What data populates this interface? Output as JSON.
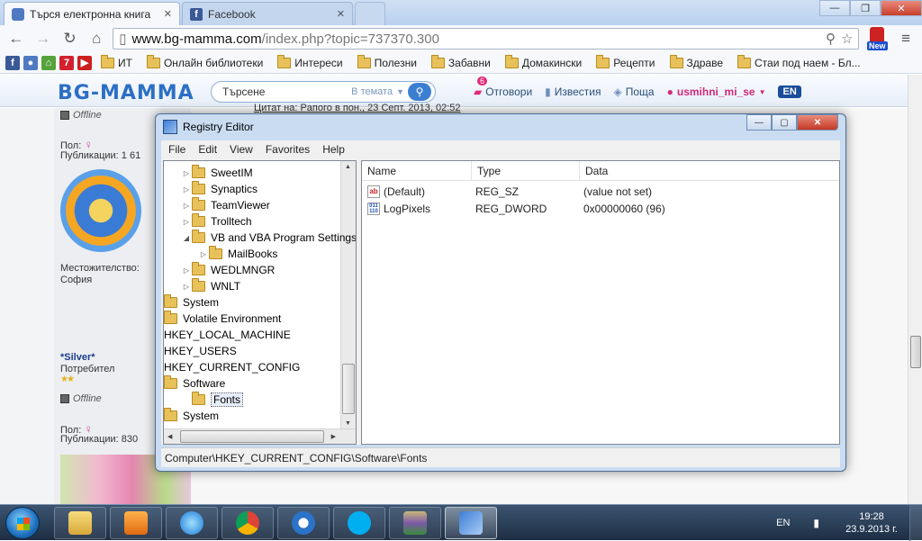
{
  "browser": {
    "tabs": [
      {
        "title": "Търся електронна книга",
        "active": true,
        "icon": "bg-mamma-favicon"
      },
      {
        "title": "Facebook",
        "active": false,
        "icon": "facebook-favicon"
      }
    ],
    "url_domain": "www.bg-mamma.com",
    "url_path": "/index.php?topic=737370.300",
    "extension_badge": "New"
  },
  "bookmarks": [
    {
      "label": "ИТ"
    },
    {
      "label": "Онлайн библиотеки"
    },
    {
      "label": "Интереси"
    },
    {
      "label": "Полезни"
    },
    {
      "label": "Забавни"
    },
    {
      "label": "Домакински"
    },
    {
      "label": "Рецепти"
    },
    {
      "label": "Здраве"
    },
    {
      "label": "Стаи под наем - Бл..."
    }
  ],
  "site": {
    "logo": "BG-MAMMA",
    "search_placeholder": "Търсене",
    "search_scope": "В темата",
    "nav": {
      "replies_label": "Отговори",
      "replies_count": "6",
      "news_label": "Известия",
      "mail_label": "Поща",
      "username": "usmihni_mi_se",
      "lang": "EN"
    },
    "quote_line": "Цитат на: Paпого в пон., 23 Септ. 2013, 02:52",
    "post1": {
      "status": "Offline",
      "gender_label": "Пол:",
      "posts_label": "Публикации: 1 61",
      "location_label": "Местожителство:",
      "location": "София"
    },
    "post2": {
      "name": "*Silver*",
      "role": "Потребител",
      "status": "Offline",
      "gender_label": "Пол:",
      "posts_label": "Публикации: 830"
    }
  },
  "regedit": {
    "title": "Registry Editor",
    "menu": [
      "File",
      "Edit",
      "View",
      "Favorites",
      "Help"
    ],
    "tree": [
      {
        "label": "SweetIM",
        "indent": 1,
        "expander": "▷",
        "folder": true
      },
      {
        "label": "Synaptics",
        "indent": 1,
        "expander": "▷",
        "folder": true
      },
      {
        "label": "TeamViewer",
        "indent": 1,
        "expander": "▷",
        "folder": true
      },
      {
        "label": "Trolltech",
        "indent": 1,
        "expander": "▷",
        "folder": true
      },
      {
        "label": "VB and VBA Program Settings",
        "indent": 1,
        "expander": "◢",
        "folder": true
      },
      {
        "label": "MailBooks",
        "indent": 2,
        "expander": "▷",
        "folder": true
      },
      {
        "label": "WEDLMNGR",
        "indent": 1,
        "expander": "▷",
        "folder": true
      },
      {
        "label": "WNLT",
        "indent": 1,
        "expander": "▷",
        "folder": true
      },
      {
        "label": "System",
        "indent": 0,
        "expander": "",
        "folder": true
      },
      {
        "label": "Volatile Environment",
        "indent": 0,
        "expander": "",
        "folder": true
      },
      {
        "label": "HKEY_LOCAL_MACHINE",
        "indent": 0,
        "expander": "",
        "folder": false
      },
      {
        "label": "HKEY_USERS",
        "indent": 0,
        "expander": "",
        "folder": false
      },
      {
        "label": "HKEY_CURRENT_CONFIG",
        "indent": 0,
        "expander": "",
        "folder": false
      },
      {
        "label": "Software",
        "indent": 0,
        "expander": "",
        "folder": true
      },
      {
        "label": "Fonts",
        "indent": 1,
        "expander": "",
        "folder": true,
        "selected": true
      },
      {
        "label": "System",
        "indent": 0,
        "expander": "",
        "folder": true
      }
    ],
    "columns": [
      "Name",
      "Type",
      "Data"
    ],
    "values": [
      {
        "name": "(Default)",
        "type": "REG_SZ",
        "data": "(value not set)",
        "icon": "string-value-icon"
      },
      {
        "name": "LogPixels",
        "type": "REG_DWORD",
        "data": "0x00000060 (96)",
        "icon": "binary-value-icon"
      }
    ],
    "status_path": "Computer\\HKEY_CURRENT_CONFIG\\Software\\Fonts"
  },
  "taskbar": {
    "apps": [
      "file-explorer",
      "media-player",
      "internet-explorer",
      "chrome",
      "maxthon",
      "skype",
      "winrar",
      "registry-editor"
    ],
    "active_app": "registry-editor",
    "lang": "EN",
    "time": "19:28",
    "date": "23.9.2013 г."
  }
}
